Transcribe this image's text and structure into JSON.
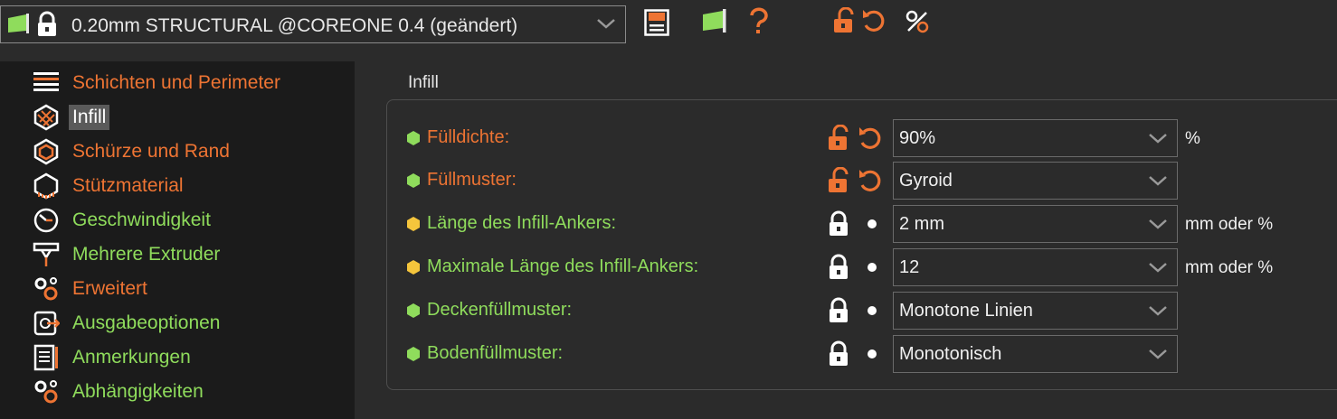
{
  "toolbar": {
    "preset_name": "0.20mm STRUCTURAL @COREONE 0.4 (geändert)",
    "icons": [
      "flag-icon",
      "lock-icon",
      "save-icon",
      "flag-icon",
      "question-icon",
      "unlock-icon",
      "undo-icon",
      "compare-icon"
    ]
  },
  "sidebar": {
    "items": [
      {
        "label": "Schichten und Perimeter",
        "icon": "layers-icon",
        "state": "modified"
      },
      {
        "label": "Infill",
        "icon": "infill-icon",
        "state": "selected"
      },
      {
        "label": "Schürze und Rand",
        "icon": "skirt-icon",
        "state": "modified"
      },
      {
        "label": "Stützmaterial",
        "icon": "support-icon",
        "state": "modified"
      },
      {
        "label": "Geschwindigkeit",
        "icon": "speed-icon",
        "state": "system"
      },
      {
        "label": "Mehrere Extruder",
        "icon": "extruder-icon",
        "state": "system"
      },
      {
        "label": "Erweitert",
        "icon": "gears-icon",
        "state": "modified"
      },
      {
        "label": "Ausgabeoptionen",
        "icon": "output-icon",
        "state": "system"
      },
      {
        "label": "Anmerkungen",
        "icon": "notes-icon",
        "state": "system"
      },
      {
        "label": "Abhängigkeiten",
        "icon": "dependencies-icon",
        "state": "system"
      }
    ]
  },
  "main": {
    "section_title": "Infill",
    "rows": [
      {
        "label": "Fülldichte:",
        "value": "90%",
        "unit": "%",
        "modified": true,
        "mode": "simple"
      },
      {
        "label": "Füllmuster:",
        "value": "Gyroid",
        "unit": "",
        "modified": true,
        "mode": "simple"
      },
      {
        "label": "Länge des Infill-Ankers:",
        "value": "2 mm",
        "unit": "mm oder %",
        "modified": false,
        "mode": "advanced"
      },
      {
        "label": "Maximale Länge des Infill-Ankers:",
        "value": "12",
        "unit": "mm oder %",
        "modified": false,
        "mode": "advanced"
      },
      {
        "label": "Deckenfüllmuster:",
        "value": "Monotone Linien",
        "unit": "",
        "modified": false,
        "mode": "simple"
      },
      {
        "label": "Bodenfüllmuster:",
        "value": "Monotonisch",
        "unit": "",
        "modified": false,
        "mode": "simple"
      }
    ]
  },
  "colors": {
    "modified": "#ee7433",
    "system": "#8fdc5c",
    "advanced_mode": "#f5c53c",
    "simple_mode": "#8fdc5c",
    "background": "#2b2b2b",
    "sidebar": "#1b1b1b"
  }
}
